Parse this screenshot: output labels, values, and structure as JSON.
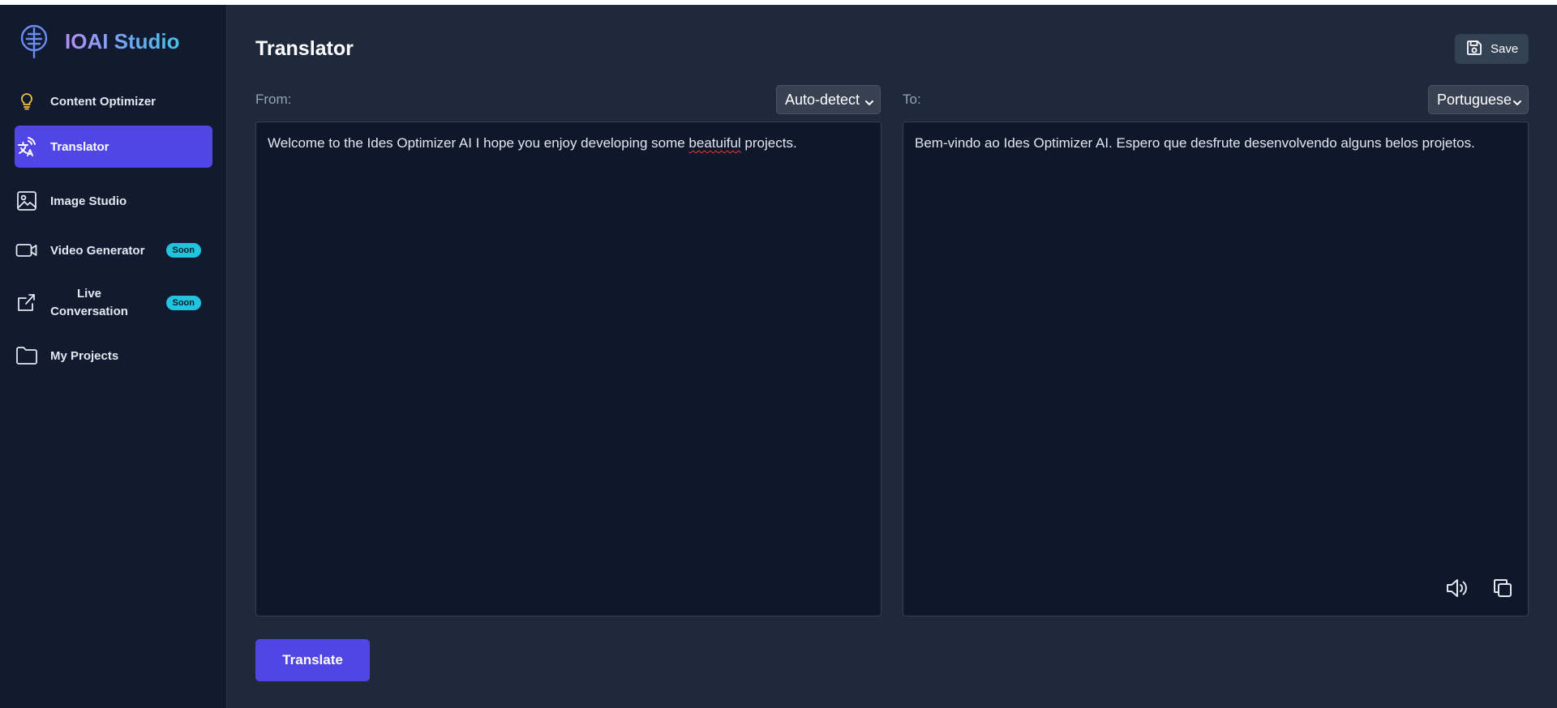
{
  "brand": {
    "name": "IOAI Studio",
    "logo_icon": "tree-logo-icon"
  },
  "sidebar": {
    "items": [
      {
        "label": "Content Optimizer",
        "icon": "lightbulb-icon",
        "active": false
      },
      {
        "label": "Translator",
        "icon": "translate-icon",
        "active": true
      },
      {
        "label": "Image Studio",
        "icon": "image-icon",
        "active": false
      },
      {
        "label": "Video Generator",
        "icon": "video-camera-icon",
        "active": false,
        "badge": "Soon"
      },
      {
        "label": "Live Conversation",
        "icon": "share-external-icon",
        "active": false,
        "badge": "Soon"
      },
      {
        "label": "My Projects",
        "icon": "folder-icon",
        "active": false
      }
    ]
  },
  "header": {
    "title": "Translator",
    "save_label": "Save"
  },
  "translator": {
    "from_label": "From:",
    "from_value": "Auto-detect",
    "to_label": "To:",
    "to_value": "Portuguese",
    "source_before": "Welcome to the Ides Optimizer AI I hope you enjoy developing some ",
    "source_misspelled": "beatuiful",
    "source_after": " projects.",
    "output_text": "Bem-vindo ao Ides Optimizer AI. Espero que desfrute desenvolvendo alguns belos projetos.",
    "translate_label": "Translate"
  },
  "colors": {
    "accent": "#5046e5",
    "badge": "#22c4dd",
    "sidebar_bg": "#111a2e",
    "main_bg": "#1e293b",
    "panel_bg": "#0f172a"
  }
}
